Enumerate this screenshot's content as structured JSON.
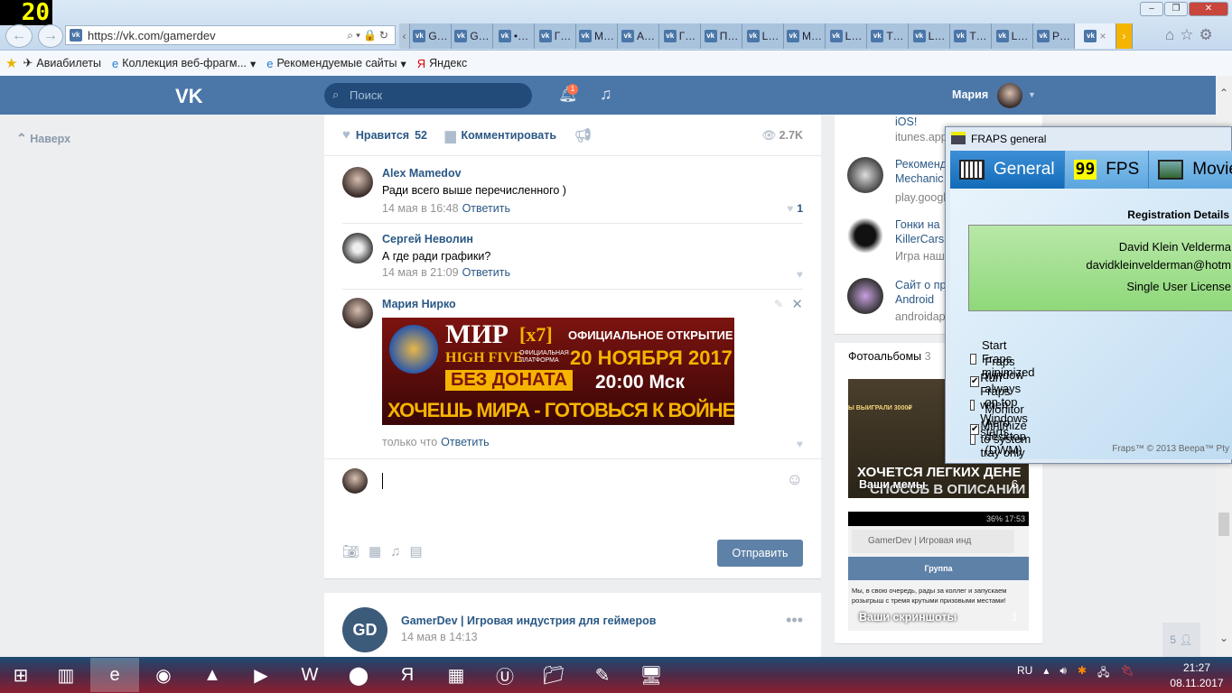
{
  "fps_overlay": "20",
  "browser": {
    "url": "https://vk.com/gamerdev",
    "tabs": [
      "G…",
      "G…",
      "•…",
      "Г…",
      "М…",
      "А…",
      "Г…",
      "П…",
      "L…",
      "М…",
      "L…",
      "Т…",
      "L…",
      "Т…",
      "L…",
      "Р…"
    ],
    "active_tab_close": "×",
    "favorites": [
      {
        "label": "Авиабилеты",
        "icon": "plane-icon"
      },
      {
        "label": "Коллекция веб-фрагм...",
        "icon": "ie-icon"
      },
      {
        "label": "Рекомендуемые сайты",
        "icon": "ie-icon"
      },
      {
        "label": "Яндекс",
        "icon": "yandex-icon"
      }
    ]
  },
  "vk": {
    "logo": "VK",
    "search_placeholder": "Поиск",
    "notifications": "1",
    "user": "Мария",
    "up": "Наверх",
    "post": {
      "like_label": "Нравится",
      "likes": "52",
      "comment_label": "Комментировать",
      "views": "2.7K"
    },
    "comments": [
      {
        "author": "Alex Mamedov",
        "text": "Ради всего выше перечисленного )",
        "time": "14 мая в 16:48",
        "reply": "Ответить",
        "likes": "1"
      },
      {
        "author": "Сергей Неволин",
        "text": "А где ради графики?",
        "time": "14 мая в 21:09",
        "reply": "Ответить",
        "likes": ""
      },
      {
        "author": "Мария Нирко",
        "text": "",
        "time": "только что",
        "reply": "Ответить",
        "likes": ""
      }
    ],
    "banner": {
      "l1": "МИР",
      "l1b": "[x7]",
      "l1c": "ОФИЦИАЛЬНОЕ ОТКРЫТИЕ",
      "l2": "HIGH FIVE",
      "l2b": "ОФИЦИАЛЬНАЯ ПЛАТФОРМА",
      "l2c": "20 НОЯБРЯ 2017",
      "l3": "БЕЗ ДОНАТА",
      "l3c": "20:00 Мск",
      "l4": "ХОЧЕШЬ МИРА - ГОТОВЬСЯ К ВОЙНЕ"
    },
    "send": "Отправить",
    "post2": {
      "author": "GamerDev | Игровая индустрия для геймеров",
      "time": "14 мая в 14:13",
      "avatar": "GD"
    },
    "ads": [
      {
        "title": "iOS!",
        "site": "itunes.app"
      },
      {
        "title": "Рекоменд\nMechanic",
        "site": "play.googl"
      },
      {
        "title": "Гонки на\nKillerCars",
        "site": "Игра наш"
      },
      {
        "title": "Сайт о пр\nAndroid",
        "site": "androidap"
      }
    ],
    "albums": {
      "title": "Фотоальбомы",
      "count": "3",
      "items": [
        {
          "label": "Ваши мемы",
          "count": "6",
          "overlay1": "ХОЧЕТСЯ ЛЕГКИХ ДЕНЕ",
          "overlay2": "СПОСОБ В ОПИСАНИИ",
          "top": "Ы ВЫИГРАЛИ 3000₽"
        },
        {
          "label": "Ваши скриншоты",
          "count": "1",
          "status": "36%  17:53",
          "urlbar": "GamerDev | Игровая инд",
          "header": "Группа",
          "body": "Мы, в свою очередь, рады за коллег и запускаем розыгрыш с тремя крутыми призовыми местами!"
        }
      ]
    },
    "friends_online": "5"
  },
  "fraps": {
    "title": "FRAPS general",
    "tabs": [
      "General",
      "FPS",
      "Movie"
    ],
    "fps_icon": "99",
    "reg_title": "Registration Details",
    "reg_name": "David Klein Velderma",
    "reg_email": "davidkleinvelderman@hotm",
    "reg_license": "Single User License",
    "options": [
      {
        "label": "Start Fraps minimized",
        "checked": false
      },
      {
        "label": "Fraps window always on top",
        "checked": true
      },
      {
        "label": "Run Fraps when Windows starts",
        "checked": false
      },
      {
        "label": "Monitor Aero desktop (DWM)",
        "checked": true
      },
      {
        "label": "Minimize to system tray only",
        "checked": false
      }
    ],
    "copyright": "Fraps™ © 2013 Beepa™ Pty"
  },
  "taskbar": {
    "lang": "RU",
    "time": "21:27",
    "date": "08.11.2017",
    "apps": [
      "start",
      "app-lineage",
      "ie",
      "chrome",
      "aimp",
      "media-player",
      "word",
      "video-player",
      "yandex",
      "lineage2",
      "ble",
      "explorer",
      "paint",
      "fraps"
    ]
  }
}
